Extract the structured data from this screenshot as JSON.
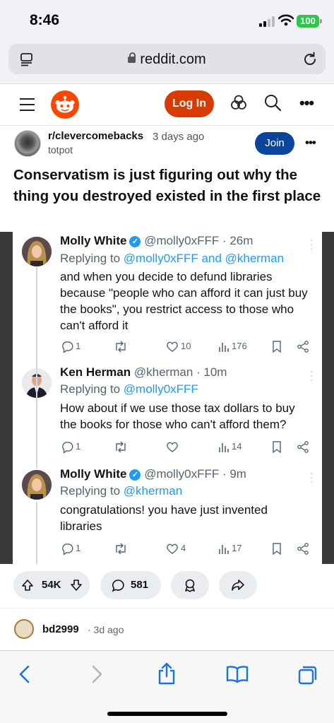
{
  "status_bar": {
    "time": "8:46",
    "battery": "100"
  },
  "browser": {
    "url": "reddit.com"
  },
  "header": {
    "login_label": "Log In"
  },
  "post": {
    "subreddit": "r/clevercomebacks",
    "time_ago": "3 days ago",
    "author": "totpot",
    "join_label": "Join",
    "title": "Conservatism is just figuring out why the thing you destroyed existed in the first place"
  },
  "tweets": [
    {
      "name": "Molly White",
      "handle": "@molly0xFFF · 26m",
      "replying_prefix": "Replying to ",
      "replying_to": "@molly0xFFF and @kherman",
      "text": "and when you decide to defund libraries because \"people who can afford it can just buy the books\", you restrict access to those who can't afford it",
      "replies": "1",
      "retweets": "",
      "likes": "10",
      "views": "176"
    },
    {
      "name": "Ken Herman",
      "handle": "@kherman · 10m",
      "replying_prefix": "Replying to ",
      "replying_to": "@molly0xFFF",
      "text": "How about if we use those tax dollars to buy the books for those who can't afford them?",
      "replies": "1",
      "retweets": "",
      "likes": "",
      "views": "14"
    },
    {
      "name": "Molly White",
      "handle": "@molly0xFFF · 9m",
      "replying_prefix": "Replying to ",
      "replying_to": "@kherman",
      "text": "congratulations! you have just invented libraries",
      "replies": "1",
      "retweets": "",
      "likes": "4",
      "views": "17"
    }
  ],
  "actions": {
    "votes": "54K",
    "comments": "581"
  },
  "comment": {
    "author": "bd2999",
    "time_ago": "· 3d ago"
  },
  "colors": {
    "reddit_orange": "#ff4500",
    "login_bg": "#d93a00",
    "join_bg": "#0a449b",
    "twitter_blue": "#1d9bf0",
    "ios_blue": "#1a73e8"
  },
  "icons": [
    "reader-icon",
    "reload-icon",
    "menu-icon",
    "reddit-logo",
    "explore-icon",
    "search-icon",
    "more-icon",
    "upvote-icon",
    "downvote-icon",
    "comment-icon",
    "award-icon",
    "share-icon",
    "back-icon",
    "forward-icon",
    "share-sheet-icon",
    "bookmarks-icon",
    "tabs-icon"
  ]
}
